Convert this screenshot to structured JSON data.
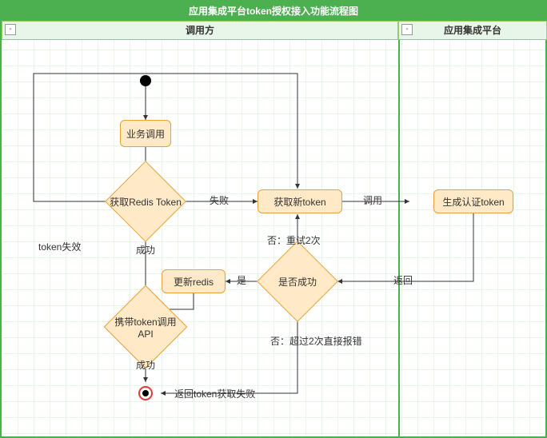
{
  "title": "应用集成平台token授权接入功能流程图",
  "lanes": {
    "left": "调用方",
    "right": "应用集成平台"
  },
  "nodes": {
    "bizCall": "业务调用",
    "getRedis": "获取Redis Token",
    "getNew": "获取新token",
    "genAuth": "生成认证token",
    "isSuccess": "是否成功",
    "updateRedis": "更新redis",
    "callApi": "携带token调用API"
  },
  "edges": {
    "tokenExpired": "token失效",
    "fail": "失败",
    "call": "调用",
    "success1": "成功",
    "success2": "成功",
    "retry": "否：重试2次",
    "yes": "是",
    "returnLbl": "返回",
    "over2": "否：超过2次直接报错",
    "returnFail": "返回token获取失败"
  },
  "collapse": "-"
}
